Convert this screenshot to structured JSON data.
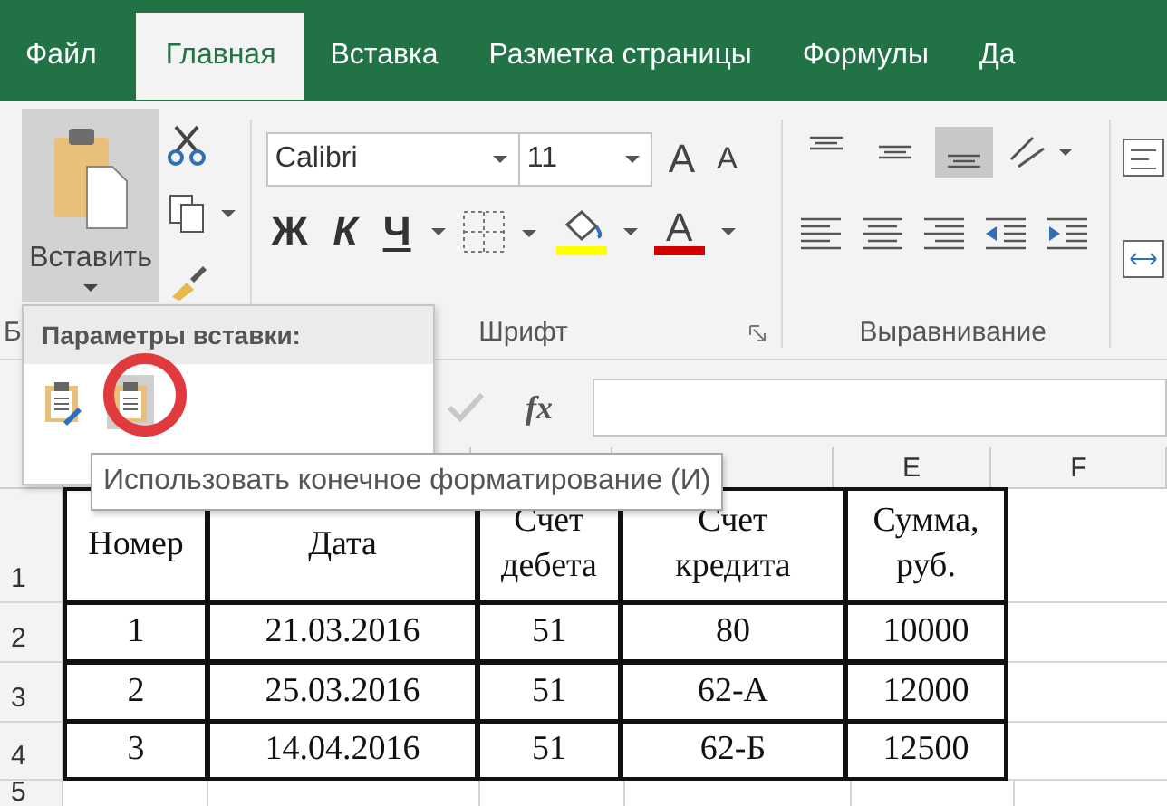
{
  "tabs": [
    {
      "label": "Файл",
      "selected": false
    },
    {
      "label": "Главная",
      "selected": true
    },
    {
      "label": "Вставка",
      "selected": false
    },
    {
      "label": "Разметка страницы",
      "selected": false
    },
    {
      "label": "Формулы",
      "selected": false
    },
    {
      "label": "Да",
      "selected": false
    }
  ],
  "ribbon": {
    "clipboard": {
      "paste_label": "Вставить",
      "group_label": "Б"
    },
    "font": {
      "font_name": "Calibri",
      "font_size": "11",
      "size_buttons": [
        {
          "kind": "grow",
          "label": "A"
        },
        {
          "kind": "shrink",
          "label": "A"
        }
      ],
      "format_buttons": [
        {
          "kind": "bold",
          "label": "Ж"
        },
        {
          "kind": "italic",
          "label": "К"
        },
        {
          "kind": "underline",
          "label": "Ч"
        }
      ],
      "color_buttons": [
        {
          "kind": "fill",
          "color": "#ffff00"
        },
        {
          "kind": "font",
          "label": "A",
          "color": "#d20000"
        }
      ],
      "group_label": "Шрифт"
    },
    "alignment": {
      "vertical": [
        {
          "kind": "top",
          "selected": false
        },
        {
          "kind": "middle",
          "selected": false
        },
        {
          "kind": "bottom",
          "selected": true
        }
      ],
      "horizontal": [
        {
          "kind": "left"
        },
        {
          "kind": "center"
        },
        {
          "kind": "right"
        },
        {
          "kind": "outdent"
        },
        {
          "kind": "indent"
        }
      ],
      "group_label": "Выравнивание"
    }
  },
  "formula_bar": {
    "fx": "fx"
  },
  "paste_options": {
    "title": "Параметры вставки:",
    "options": [
      {
        "kind": "keep",
        "selected": false
      },
      {
        "kind": "destination",
        "selected": true
      }
    ],
    "tooltip": "Использовать конечное форматирование (И)"
  },
  "sheet": {
    "column_headers": [
      "E",
      "F"
    ],
    "rows": [
      {
        "number": "1",
        "cells": [
          "Номер",
          "Дата",
          "Счет дебета",
          "Счет кредита",
          "Сумма, руб."
        ]
      },
      {
        "number": "2",
        "cells": [
          "1",
          "21.03.2016",
          "51",
          "80",
          "10000"
        ]
      },
      {
        "number": "3",
        "cells": [
          "2",
          "25.03.2016",
          "51",
          "62-А",
          "12000"
        ]
      },
      {
        "number": "4",
        "cells": [
          "3",
          "14.04.2016",
          "51",
          "62-Б",
          "12500"
        ]
      },
      {
        "number": "5"
      }
    ]
  }
}
